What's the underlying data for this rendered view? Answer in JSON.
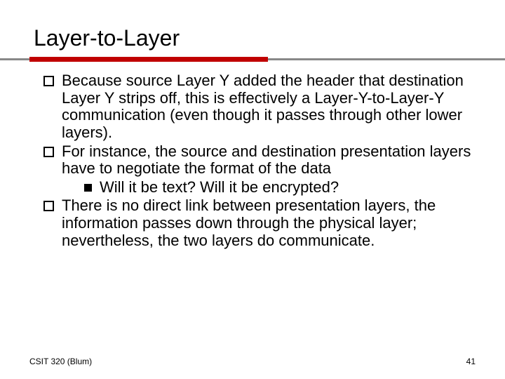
{
  "title": "Layer-to-Layer",
  "bullets": {
    "b1": "Because source Layer Y added the header that destination Layer Y strips off, this is effectively a Layer-Y-to-Layer-Y communication (even though it passes through other lower layers).",
    "b2": "For instance, the source and destination presentation layers have to negotiate the format of the data",
    "b2_sub1": "Will it be text?   Will it be encrypted?",
    "b3": "There is no direct link between presentation layers, the information passes down through the physical layer; nevertheless, the two layers do communicate."
  },
  "footer": {
    "left": "CSIT 320 (Blum)",
    "right": "41"
  }
}
